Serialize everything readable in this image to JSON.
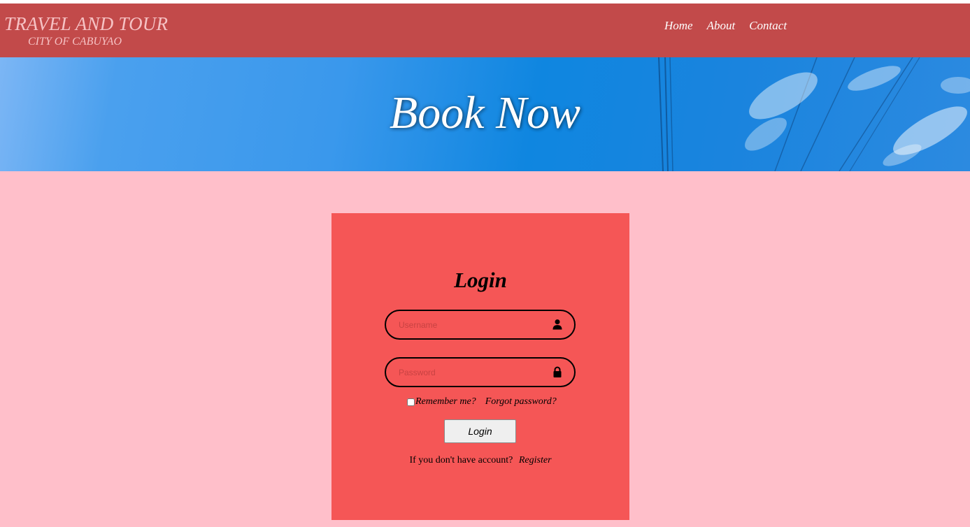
{
  "header": {
    "brand_title": "TRAVEL AND TOUR",
    "brand_subtitle": "CITY OF CABUYAO",
    "nav": [
      {
        "label": "Home"
      },
      {
        "label": "About"
      },
      {
        "label": "Contact"
      }
    ]
  },
  "hero": {
    "title": "Book Now"
  },
  "login": {
    "title": "Login",
    "username_placeholder": "Username",
    "password_placeholder": "Password",
    "remember_label": "Remember me?",
    "forgot_label": "Forgot password?",
    "button_label": "Login",
    "register_prompt": "If you don't have account?",
    "register_link": "Register"
  },
  "icons": {
    "username": "user-icon",
    "password": "lock-icon"
  },
  "colors": {
    "header_bg": "#c24a4a",
    "page_bg": "#ffbfca",
    "card_bg": "#f55656",
    "brand_text": "#f6c2c4"
  }
}
